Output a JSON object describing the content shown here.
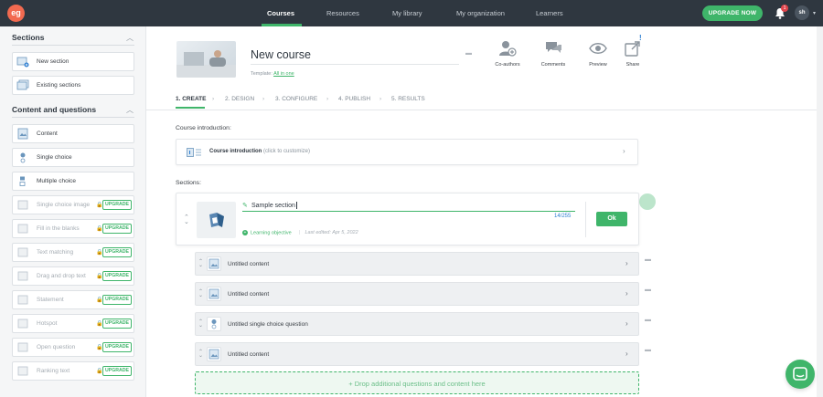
{
  "topbar": {
    "logo_text": "eg",
    "nav": [
      {
        "label": "Courses"
      },
      {
        "label": "Resources"
      },
      {
        "label": "My library"
      },
      {
        "label": "My organization"
      },
      {
        "label": "Learners"
      }
    ],
    "upgrade_label": "UPGRADE NOW",
    "notification_count": "1",
    "avatar_initials": "sh",
    "accent_color": "#3fb56a"
  },
  "sidebar": {
    "sections_title": "Sections",
    "section_items": [
      {
        "label": "New section"
      },
      {
        "label": "Existing sections"
      }
    ],
    "content_title": "Content and questions",
    "content_items": [
      {
        "label": "Content",
        "locked": false
      },
      {
        "label": "Single choice",
        "locked": false
      },
      {
        "label": "Multiple choice",
        "locked": false
      },
      {
        "label": "Single choice image",
        "locked": true
      },
      {
        "label": "Fill in the blanks",
        "locked": true
      },
      {
        "label": "Text matching",
        "locked": true
      },
      {
        "label": "Drag and drop text",
        "locked": true
      },
      {
        "label": "Statement",
        "locked": true
      },
      {
        "label": "Hotspot",
        "locked": true
      },
      {
        "label": "Open question",
        "locked": true
      },
      {
        "label": "Ranking text",
        "locked": true
      }
    ],
    "upgrade_badge": "UPGRADE"
  },
  "course": {
    "title": "New course",
    "template_prefix": "Template: ",
    "template_link": "All in one"
  },
  "actions": [
    {
      "label": "Co-authors",
      "icon": "co-authors-icon"
    },
    {
      "label": "Comments",
      "icon": "comments-icon"
    },
    {
      "label": "Preview",
      "icon": "eye-icon"
    },
    {
      "label": "Share",
      "icon": "share-icon"
    }
  ],
  "share_alert": "!",
  "steps": [
    {
      "label": "1. CREATE",
      "active": true
    },
    {
      "label": "2. DESIGN",
      "active": false
    },
    {
      "label": "3. CONFIGURE",
      "active": false
    },
    {
      "label": "4. PUBLISH",
      "active": false
    },
    {
      "label": "5. RESULTS",
      "active": false
    }
  ],
  "intro": {
    "label": "Course introduction:",
    "card_title": "Course introduction",
    "card_hint": " (click to customize)"
  },
  "sections": {
    "label": "Sections:",
    "editing": {
      "name": "Sample section",
      "count": "14/255",
      "objective": "Learning objective",
      "last_edited": "Last edited: Apr 5, 2022",
      "ok_label": "Ok"
    },
    "rows": [
      {
        "label": "Untitled content"
      },
      {
        "label": "Untitled content"
      },
      {
        "label": "Untitled single choice question"
      },
      {
        "label": "Untitled content"
      }
    ],
    "drop_label": "+ Drop additional questions and content here"
  }
}
